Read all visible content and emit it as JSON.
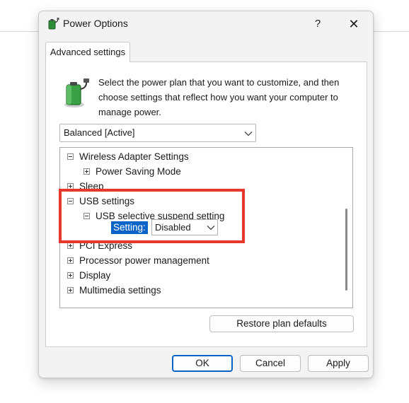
{
  "window": {
    "title": "Power Options",
    "help_label": "?",
    "close_label": "✕"
  },
  "tab": {
    "label": "Advanced settings"
  },
  "description": "Select the power plan that you want to customize, and then choose settings that reflect how you want your computer to manage power.",
  "plan_select": {
    "value": "Balanced [Active]"
  },
  "tree": {
    "wireless": "Wireless Adapter Settings",
    "power_saving": "Power Saving Mode",
    "sleep": "Sleep",
    "usb": "USB settings",
    "usb_suspend": "USB selective suspend setting",
    "setting_label": "Setting:",
    "setting_value": "Disabled",
    "pci": "PCI Express",
    "processor": "Processor power management",
    "display": "Display",
    "multimedia": "Multimedia settings"
  },
  "buttons": {
    "restore": "Restore plan defaults",
    "ok": "OK",
    "cancel": "Cancel",
    "apply": "Apply"
  },
  "colors": {
    "highlight": "#e8382b",
    "selection": "#0a64c8",
    "dialog_bg": "#f3f3f3"
  },
  "icons": {
    "app": "power-options-icon",
    "battery": "battery-plug-icon"
  }
}
